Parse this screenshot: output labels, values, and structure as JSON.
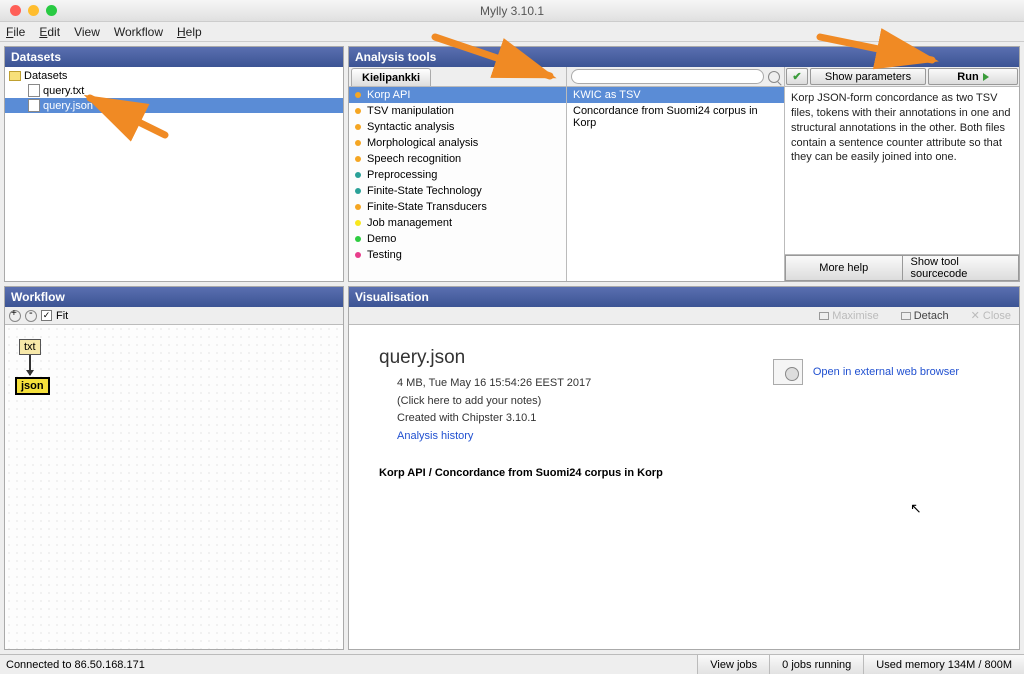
{
  "app": {
    "title": "Mylly 3.10.1"
  },
  "menu": {
    "file": "File",
    "edit": "Edit",
    "view": "View",
    "workflow": "Workflow",
    "help": "Help"
  },
  "panels": {
    "datasets": "Datasets",
    "analysis": "Analysis tools",
    "workflow": "Workflow",
    "visualisation": "Visualisation"
  },
  "datasets": {
    "root": "Datasets",
    "items": [
      {
        "name": "query.txt",
        "selected": false
      },
      {
        "name": "query.json",
        "selected": true
      }
    ]
  },
  "analysis": {
    "tab": "Kielipankki",
    "categories": [
      {
        "label": "Korp API",
        "color": "#f5a623",
        "selected": true
      },
      {
        "label": "TSV manipulation",
        "color": "#f5a623"
      },
      {
        "label": "Syntactic analysis",
        "color": "#f5a623"
      },
      {
        "label": "Morphological analysis",
        "color": "#f5a623"
      },
      {
        "label": "Speech recognition",
        "color": "#f5a623"
      },
      {
        "label": "Preprocessing",
        "color": "#2aa198"
      },
      {
        "label": "Finite-State Technology",
        "color": "#2aa198"
      },
      {
        "label": "Finite-State Transducers",
        "color": "#f5a623"
      },
      {
        "label": "Job management",
        "color": "#f8e71c"
      },
      {
        "label": "Demo",
        "color": "#2ecc40"
      },
      {
        "label": "Testing",
        "color": "#e83e8c"
      }
    ],
    "selected_tool": "KWIC as TSV",
    "secondary_text": "Concordance from Suomi24 corpus in Korp",
    "search_placeholder": "",
    "buttons": {
      "show_params": "Show parameters",
      "run": "Run",
      "more_help": "More help",
      "show_source": "Show tool sourcecode"
    },
    "description": "Korp JSON-form concordance as two TSV files, tokens with their annotations in one and structural annotations in the other. Both files contain a sentence counter attribute so that they can be easily joined into one."
  },
  "workflow": {
    "fit_label": "Fit",
    "nodes": {
      "txt": "txt",
      "json": "json"
    }
  },
  "visualisation": {
    "toolbar": {
      "maximise": "Maximise",
      "detach": "Detach",
      "close": "Close"
    },
    "title": "query.json",
    "size_line": "4 MB, Tue May 16 15:54:26 EEST 2017",
    "notes_hint": "(Click here to add your notes)",
    "created": "Created with Chipster 3.10.1",
    "history_link": "Analysis history",
    "path": "Korp API / Concordance from Suomi24 corpus in Korp",
    "external_link": "Open in external web browser"
  },
  "status": {
    "connection": "Connected to 86.50.168.171",
    "view_jobs": "View jobs",
    "jobs_running": "0 jobs running",
    "memory": "Used memory 134M / 800M"
  }
}
